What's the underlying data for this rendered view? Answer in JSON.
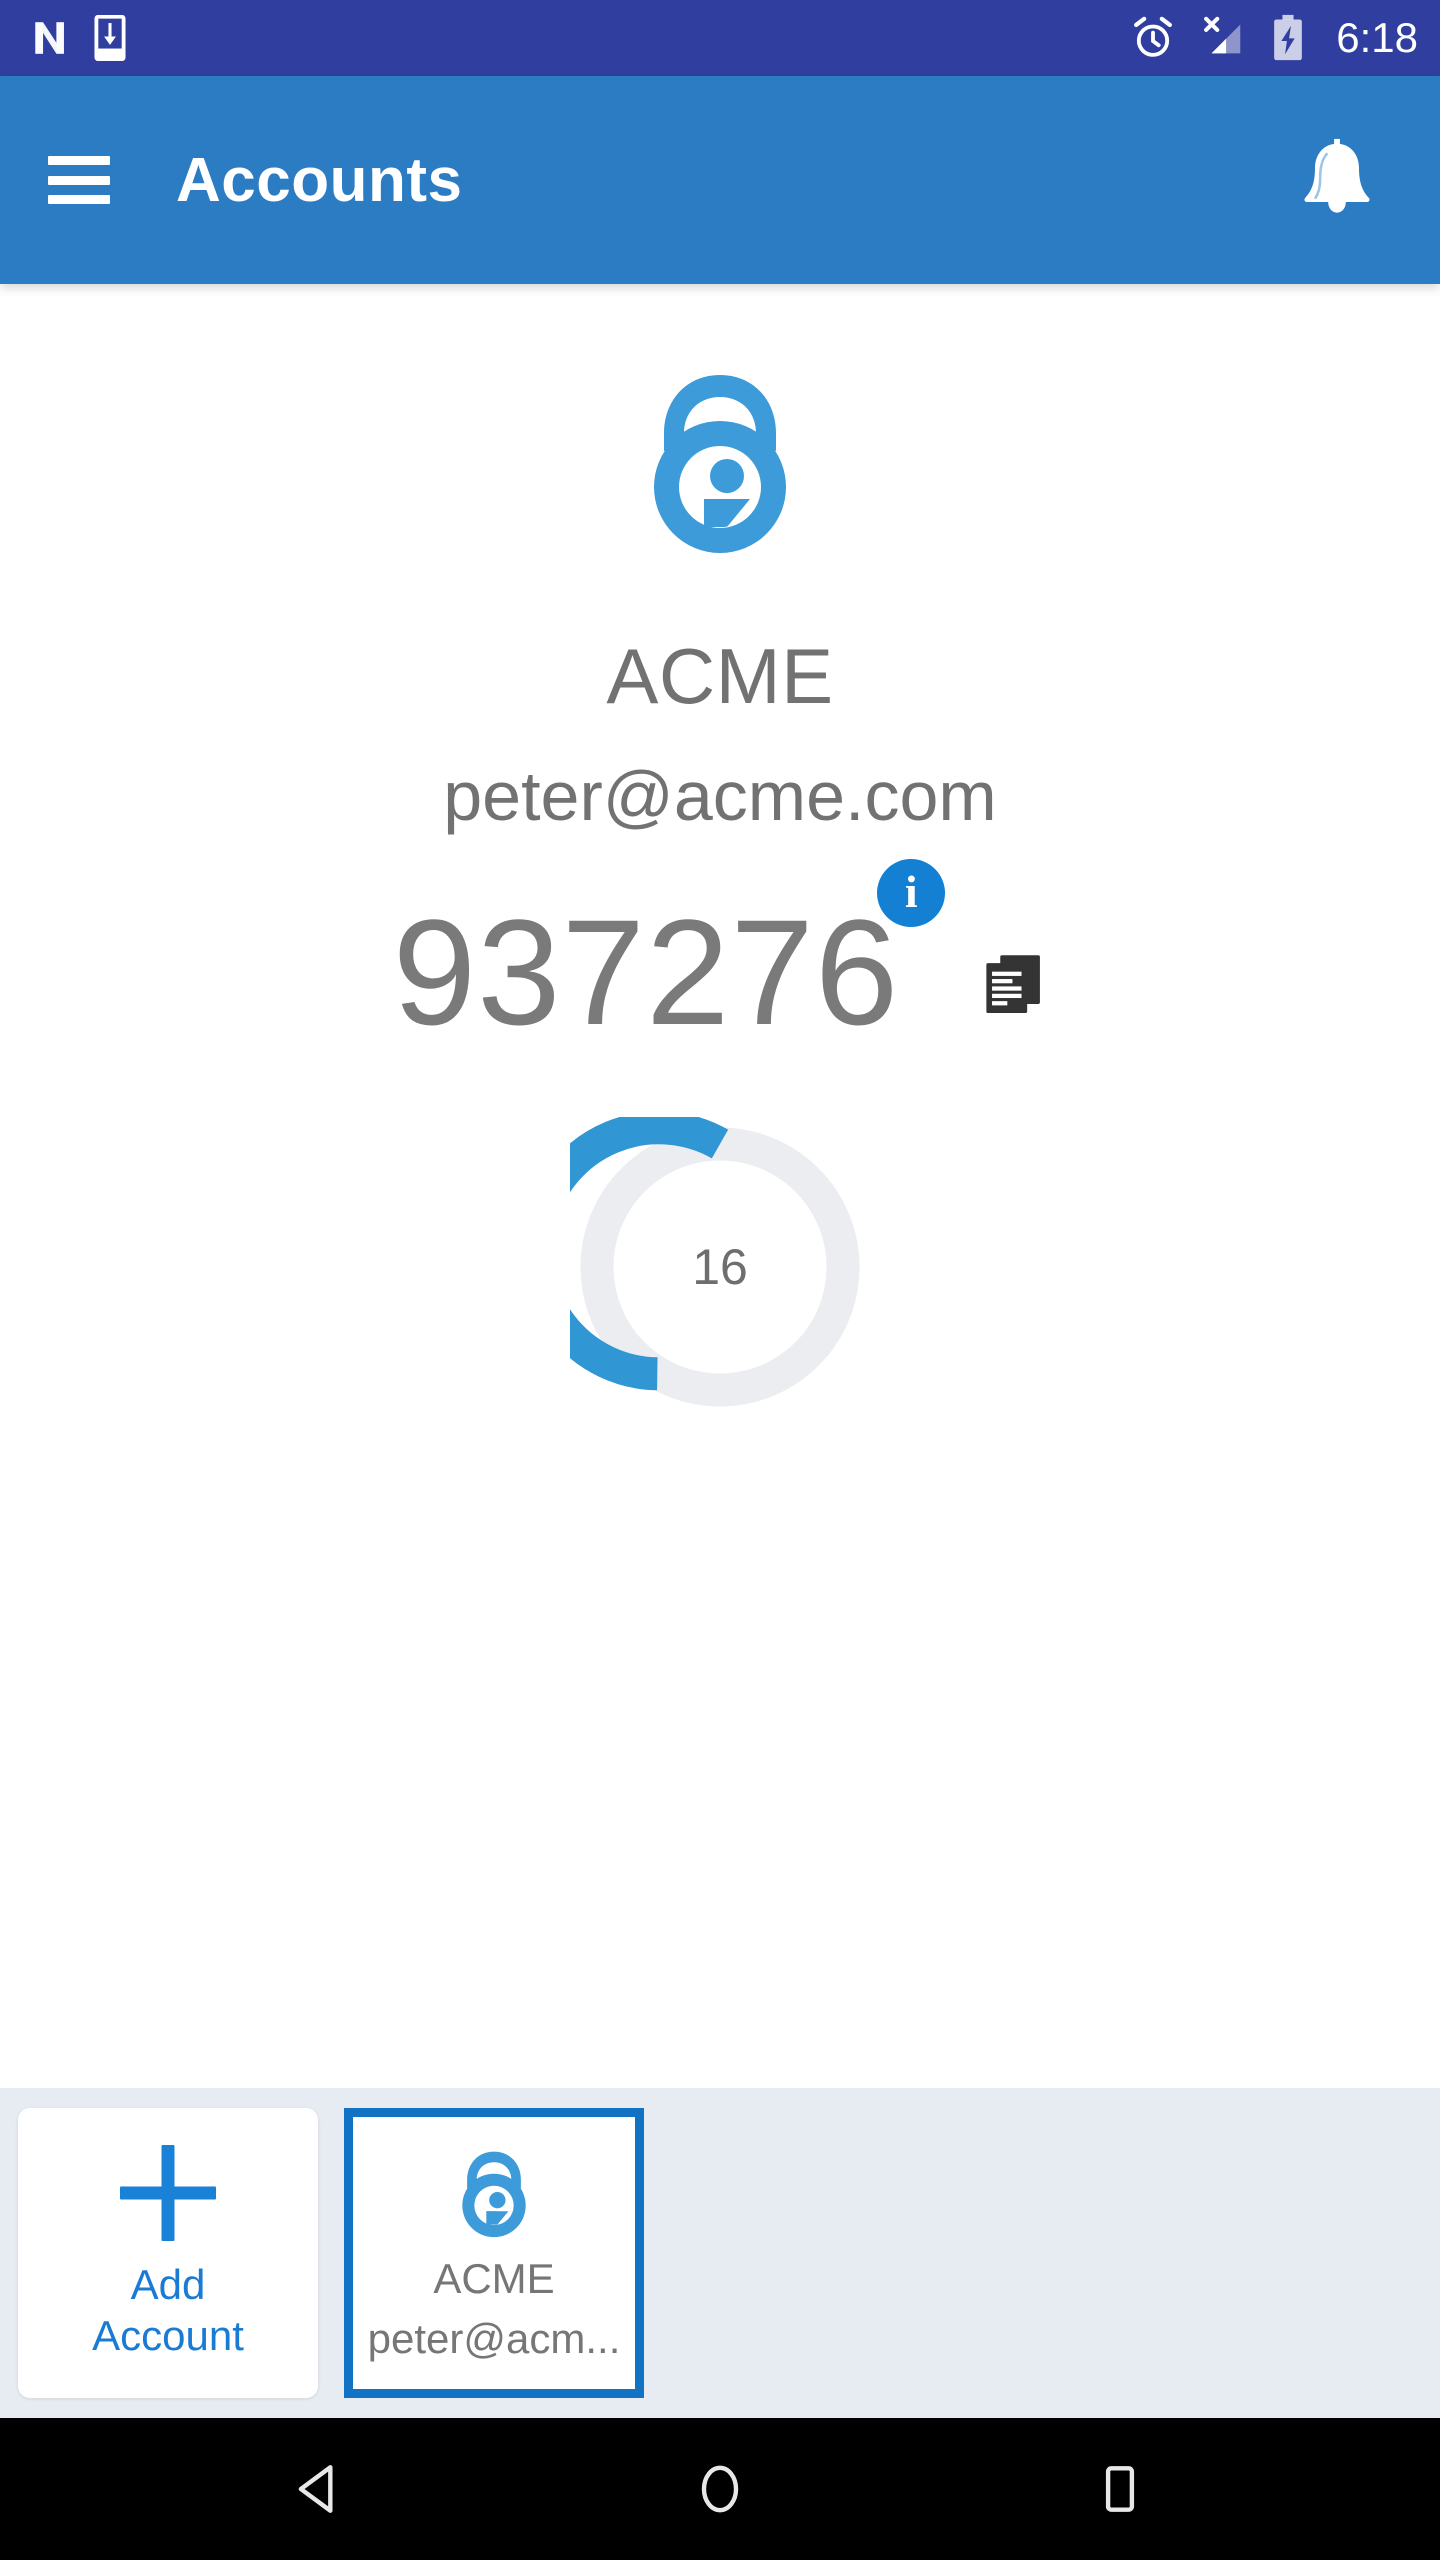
{
  "status_bar": {
    "background": "#303F9F",
    "time": "6:18",
    "icons": [
      {
        "name": "android-n-logo"
      },
      {
        "name": "download-to-device-icon"
      },
      {
        "name": "alarm-icon"
      },
      {
        "name": "signal-no-service-icon"
      },
      {
        "name": "battery-charging-icon"
      }
    ]
  },
  "app_bar": {
    "background": "#2C7CC3",
    "title": "Accounts",
    "menu_icon": "hamburger-menu-icon",
    "notification_icon": "bell-icon"
  },
  "account": {
    "logo_icon": "lastpass-authenticator-lock-icon",
    "issuer": "ACME",
    "email": "peter@acme.com",
    "otp_code": "937276",
    "info_badge_label": "i",
    "copy_icon": "copy-to-clipboard-icon",
    "timer": {
      "seconds_remaining": "16",
      "total_seconds": 30,
      "arc_color": "#3196D4",
      "track_color": "#ECEDF0"
    }
  },
  "accounts_strip": {
    "background": "#E7ECF2",
    "add_card": {
      "icon": "plus-icon",
      "label_line1": "Add",
      "label_line2": "Account",
      "color": "#1A7BD4"
    },
    "accounts": [
      {
        "icon": "lastpass-authenticator-lock-icon",
        "issuer": "ACME",
        "email": "peter@acm...",
        "selected": true,
        "selected_border_color": "#1272C4"
      }
    ]
  },
  "nav_bar": {
    "background": "#000000",
    "buttons": [
      {
        "name": "back-button",
        "icon": "triangle-back-icon"
      },
      {
        "name": "home-button",
        "icon": "circle-home-icon"
      },
      {
        "name": "recents-button",
        "icon": "square-recents-icon"
      }
    ]
  }
}
